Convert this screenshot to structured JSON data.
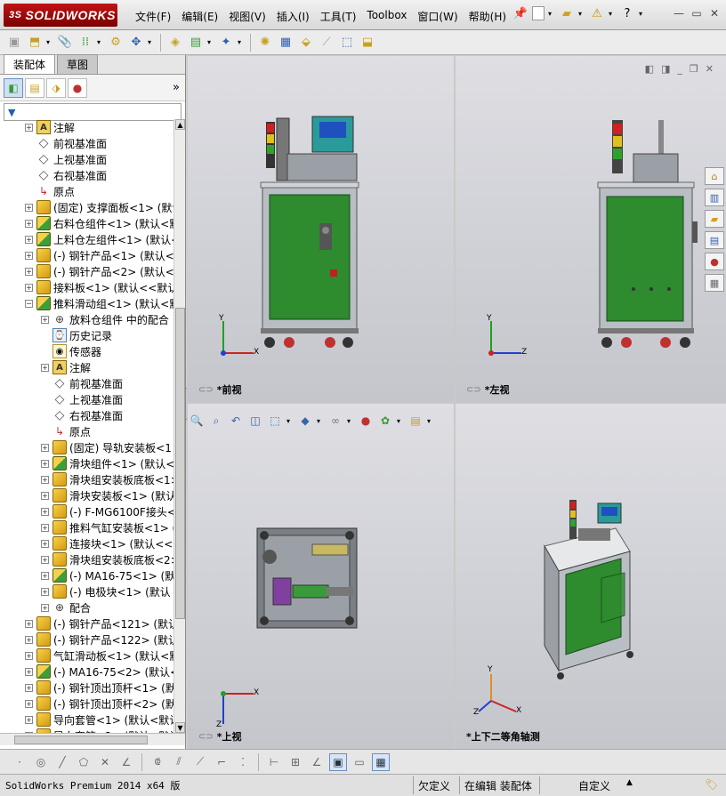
{
  "app": {
    "brand": "SOLIDWORKS",
    "brand_prefix": "3S"
  },
  "menu": [
    "文件(F)",
    "编辑(E)",
    "视图(V)",
    "插入(I)",
    "工具(T)",
    "Toolbox",
    "窗口(W)",
    "帮助(H)"
  ],
  "title_icons": [
    "pin-icon",
    "new-icon",
    "open-icon",
    "rebuild-icon",
    "help-icon"
  ],
  "window_controls": [
    "minimize",
    "restore",
    "close"
  ],
  "toolbar_icons": [
    "assembly-icon",
    "insert-components-icon",
    "mate-icon",
    "linear-pattern-icon",
    "smart-fastener-icon",
    "move-component-icon",
    "show-hidden-icon",
    "assembly-features-icon",
    "reference-geometry-icon",
    "new-motion-study-icon",
    "bill-of-materials-icon",
    "exploded-view-icon",
    "explode-line-icon",
    "interference-icon",
    "clearance-icon"
  ],
  "panel_tabs": [
    "装配体",
    "草图"
  ],
  "tree": [
    {
      "label": "注解",
      "indent": 1,
      "exp": "+",
      "icon": "anno"
    },
    {
      "label": "前视基准面",
      "indent": 1,
      "exp": "",
      "icon": "plane"
    },
    {
      "label": "上视基准面",
      "indent": 1,
      "exp": "",
      "icon": "plane"
    },
    {
      "label": "右视基准面",
      "indent": 1,
      "exp": "",
      "icon": "plane"
    },
    {
      "label": "原点",
      "indent": 1,
      "exp": "",
      "icon": "origin"
    },
    {
      "label": "(固定) 支撑面板<1> (默认",
      "indent": 1,
      "exp": "+",
      "icon": "part"
    },
    {
      "label": "右料仓组件<1> (默认<默",
      "indent": 1,
      "exp": "+",
      "icon": "asm"
    },
    {
      "label": "上料仓左组件<1> (默认<",
      "indent": 1,
      "exp": "+",
      "icon": "asm"
    },
    {
      "label": "(-) 钢针产品<1> (默认<",
      "indent": 1,
      "exp": "+",
      "icon": "part"
    },
    {
      "label": "(-) 钢针产品<2> (默认<",
      "indent": 1,
      "exp": "+",
      "icon": "part"
    },
    {
      "label": "接料板<1> (默认<<默认>",
      "indent": 1,
      "exp": "+",
      "icon": "part"
    },
    {
      "label": "推料滑动组<1> (默认<默",
      "indent": 1,
      "exp": "-",
      "icon": "asm"
    },
    {
      "label": "放料仓组件 中的配合",
      "indent": 2,
      "exp": "+",
      "icon": "mate"
    },
    {
      "label": "历史记录",
      "indent": 2,
      "exp": "",
      "icon": "hist"
    },
    {
      "label": "传感器",
      "indent": 2,
      "exp": "",
      "icon": "sensor"
    },
    {
      "label": "注解",
      "indent": 2,
      "exp": "+",
      "icon": "anno"
    },
    {
      "label": "前视基准面",
      "indent": 2,
      "exp": "",
      "icon": "plane"
    },
    {
      "label": "上视基准面",
      "indent": 2,
      "exp": "",
      "icon": "plane"
    },
    {
      "label": "右视基准面",
      "indent": 2,
      "exp": "",
      "icon": "plane"
    },
    {
      "label": "原点",
      "indent": 2,
      "exp": "",
      "icon": "origin"
    },
    {
      "label": "(固定) 导轨安装板<1",
      "indent": 2,
      "exp": "+",
      "icon": "part"
    },
    {
      "label": "滑块组件<1> (默认<默",
      "indent": 2,
      "exp": "+",
      "icon": "asm"
    },
    {
      "label": "滑块组安装板底板<1>",
      "indent": 2,
      "exp": "+",
      "icon": "part"
    },
    {
      "label": "滑块安装板<1> (默认",
      "indent": 2,
      "exp": "+",
      "icon": "part"
    },
    {
      "label": "(-) F-MG6100F接头<1",
      "indent": 2,
      "exp": "+",
      "icon": "part"
    },
    {
      "label": "推料气缸安装板<1> (",
      "indent": 2,
      "exp": "+",
      "icon": "part"
    },
    {
      "label": "连接块<1> (默认<<默",
      "indent": 2,
      "exp": "+",
      "icon": "part"
    },
    {
      "label": "滑块组安装板底板<2>",
      "indent": 2,
      "exp": "+",
      "icon": "part"
    },
    {
      "label": "(-) MA16-75<1> (默认",
      "indent": 2,
      "exp": "+",
      "icon": "asm"
    },
    {
      "label": "(-) 电极块<1> (默认",
      "indent": 2,
      "exp": "+",
      "icon": "part"
    },
    {
      "label": "配合",
      "indent": 2,
      "exp": "+",
      "icon": "mate"
    },
    {
      "label": "(-) 钢针产品<121> (默认",
      "indent": 1,
      "exp": "+",
      "icon": "part"
    },
    {
      "label": "(-) 钢针产品<122> (默认",
      "indent": 1,
      "exp": "+",
      "icon": "part"
    },
    {
      "label": "气缸滑动板<1> (默认<默",
      "indent": 1,
      "exp": "+",
      "icon": "part"
    },
    {
      "label": "(-) MA16-75<2> (默认<默",
      "indent": 1,
      "exp": "+",
      "icon": "asm"
    },
    {
      "label": "(-) 钢针顶出顶杆<1> (默",
      "indent": 1,
      "exp": "+",
      "icon": "part"
    },
    {
      "label": "(-) 钢针顶出顶杆<2> (默",
      "indent": 1,
      "exp": "+",
      "icon": "part"
    },
    {
      "label": "导向套管<1> (默认<默认",
      "indent": 1,
      "exp": "+",
      "icon": "part"
    },
    {
      "label": "导向套管<2> (默认<默认",
      "indent": 1,
      "exp": "+",
      "icon": "part"
    }
  ],
  "viewports": {
    "front": "*前视",
    "left": "*左视",
    "top": "*上视",
    "iso": "*上下二等角轴测"
  },
  "axes": {
    "x": "X",
    "y": "Y",
    "z": "Z"
  },
  "status": {
    "product": "SolidWorks Premium 2014 x64 版",
    "defined": "欠定义",
    "editing": "在编辑 装配体",
    "units": "自定义"
  },
  "colors": {
    "frame_green": "#2e8b2e",
    "frame_steel": "#9aa4ae",
    "axis_x": "#d02020",
    "axis_y": "#20a020",
    "axis_z": "#2040d0"
  }
}
